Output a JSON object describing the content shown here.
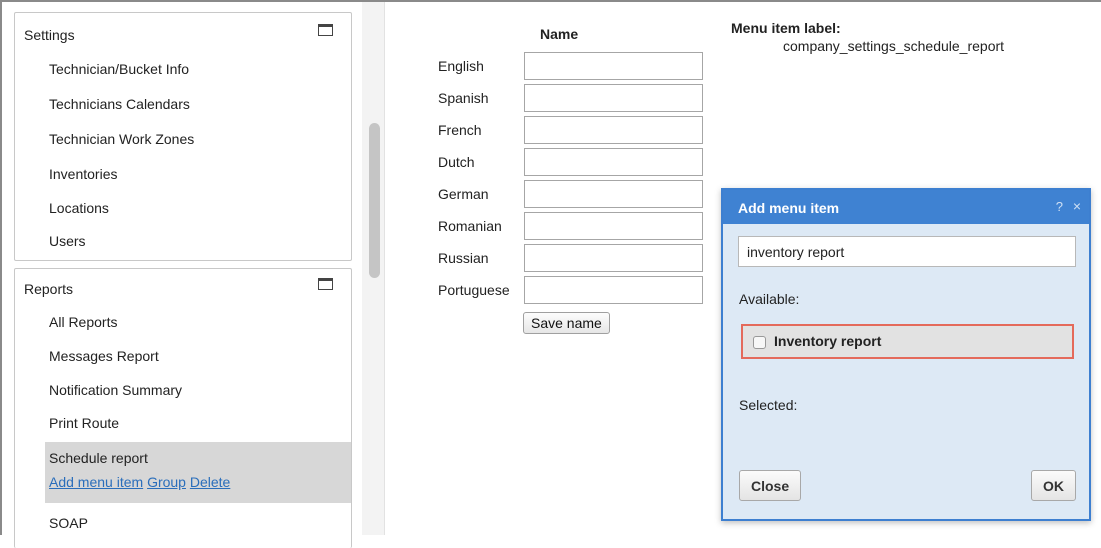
{
  "settings_panel": {
    "title": "Settings",
    "items": [
      {
        "label": "Technician/Bucket Info"
      },
      {
        "label": "Technicians Calendars"
      },
      {
        "label": "Technician Work Zones"
      },
      {
        "label": "Inventories"
      },
      {
        "label": "Locations"
      },
      {
        "label": "Users"
      }
    ]
  },
  "reports_panel": {
    "title": "Reports",
    "items": [
      {
        "label": "All Reports"
      },
      {
        "label": "Messages Report"
      },
      {
        "label": "Notification Summary"
      },
      {
        "label": "Print Route"
      }
    ],
    "selected_item": {
      "label": "Schedule report",
      "actions": {
        "add": "Add menu item",
        "group": "Group",
        "delete": "Delete"
      }
    },
    "after_items": [
      {
        "label": "SOAP"
      }
    ]
  },
  "names_form": {
    "header": "Name",
    "languages": [
      {
        "label": "English",
        "value": ""
      },
      {
        "label": "Spanish",
        "value": ""
      },
      {
        "label": "French",
        "value": ""
      },
      {
        "label": "Dutch",
        "value": ""
      },
      {
        "label": "German",
        "value": ""
      },
      {
        "label": "Romanian",
        "value": ""
      },
      {
        "label": "Russian",
        "value": ""
      },
      {
        "label": "Portuguese",
        "value": ""
      }
    ],
    "save_label": "Save name"
  },
  "menu_item": {
    "label_title": "Menu item label:",
    "label_value": "company_settings_schedule_report"
  },
  "dialog": {
    "title": "Add menu item",
    "help_icon": "?",
    "close_icon": "×",
    "search_value": "inventory report",
    "available_label": "Available:",
    "available_items": [
      {
        "label": "Inventory report",
        "checked": false
      }
    ],
    "selected_label": "Selected:",
    "close_label": "Close",
    "ok_label": "OK"
  },
  "colors": {
    "dialog_header": "#3f82d2",
    "dialog_body": "#dde9f5",
    "highlight_border": "#e46a5b",
    "selected_item_bg": "#d7d7d7",
    "link": "#2a6ebb"
  }
}
